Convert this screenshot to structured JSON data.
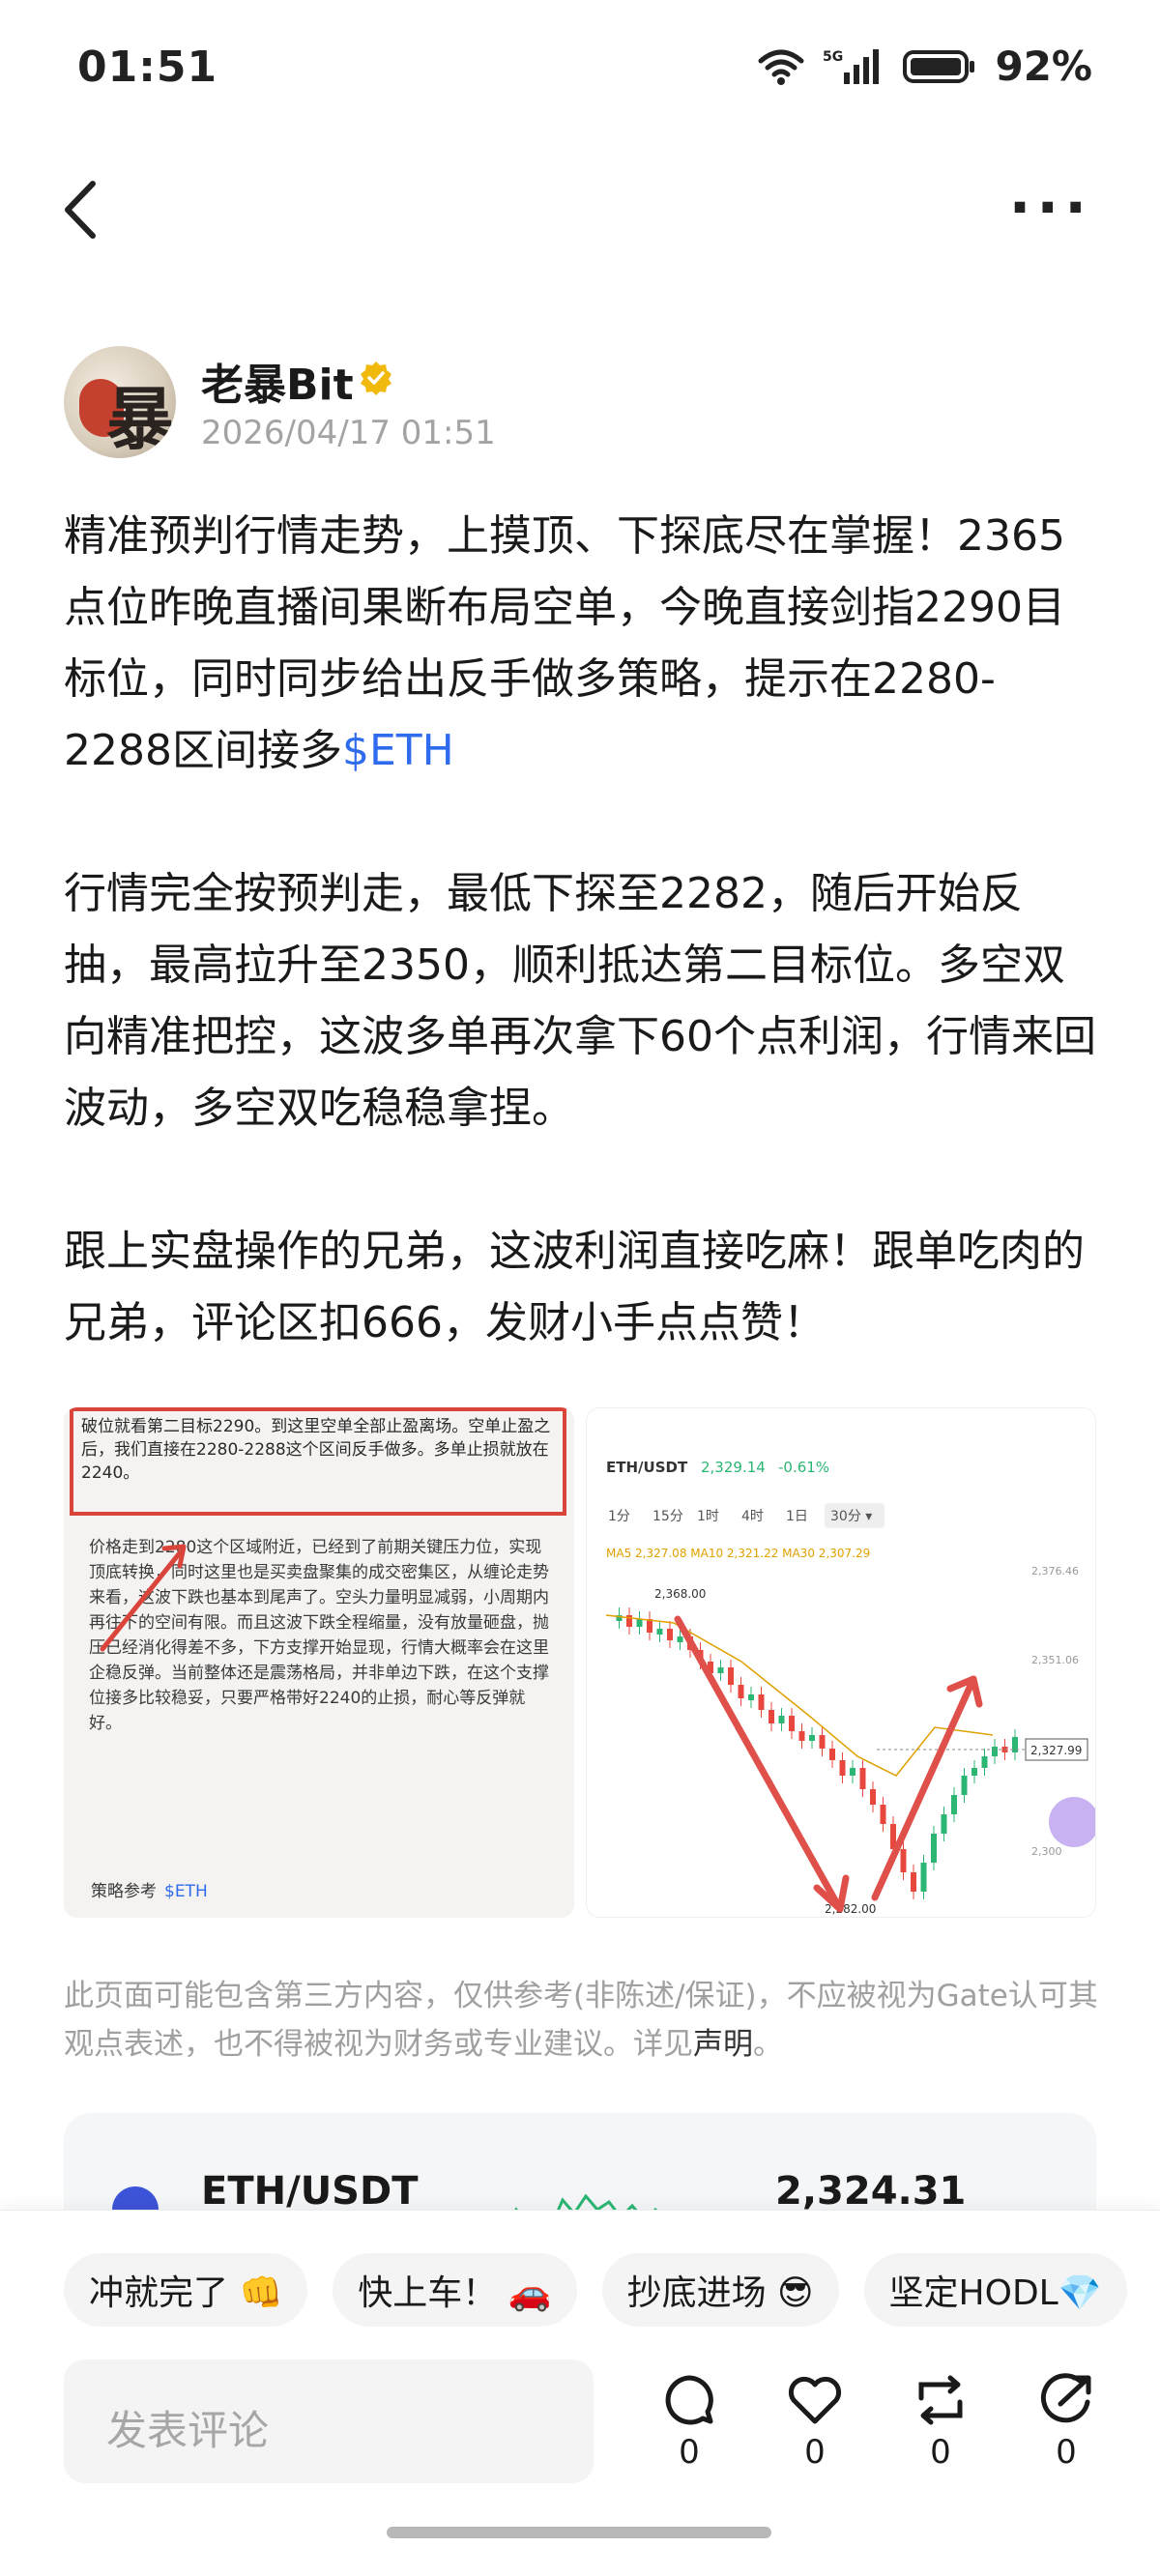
{
  "status_bar": {
    "time": "01:51",
    "network": "5G",
    "battery": "92%"
  },
  "author": {
    "name": "老暴Bit",
    "time": "2026/04/17 01:51",
    "avatar_text": "暴"
  },
  "post": {
    "p1": "精准预判行情走势，上摸顶、下探底尽在掌握！2365点位昨晚直播间果断布局空单，今晚直接剑指2290目标位，同时同步给出反手做多策略，提示在2280-2288区间接多",
    "p1_tag": "$ETH",
    "p2": "行情完全按预判走，最低下探至2282，随后开始反抽，最高拉升至2350，顺利抵达第二目标位。多空双向精准把控，这波多单再次拿下60个点利润，行情来回波动，多空双吃稳稳拿捏。",
    "p3": "跟上实盘操作的兄弟，这波利润直接吃麻！跟单吃肉的兄弟，评论区扣666，发财小手点点赞！"
  },
  "image_left": {
    "box_text": "破位就看第二目标2290。到这里空单全部止盈离场。空单止盈之后，我们直接在2280-2288这个区间反手做多。多单止损就放在2240。",
    "body_text": "价格走到2280这个区域附近，已经到了前期关键压力位，实现顶底转换，同时这里也是买卖盘聚集的成交密集区，从缠论走势来看，这波下跌也基本到尾声了。空头力量明显减弱，小周期内再往下的空间有限。而且这波下跌全程缩量，没有放量砸盘，抛压已经消化得差不多，下方支撑开始显现，行情大概率会在这里企稳反弹。当前整体还是震荡格局，并非单边下跌，在这个支撑位接多比较稳妥，只要严格带好2240的止损，耐心等反弹就好。",
    "footer": "策略参考",
    "footer_tag": "$ETH"
  },
  "image_right": {
    "pair": "ETH/USDT",
    "price": "2,329.14",
    "change": "-0.61%",
    "timeframes": [
      "1分",
      "15分",
      "1时",
      "4时",
      "1日",
      "30分 ▾"
    ],
    "ma_text": "MA5 2,327.08  MA10 2,321.22  MA30 2,307.29",
    "high_label": "2,368.00",
    "low_label": "2,282.00",
    "current_label": "2,327.99",
    "axis": [
      "2,376.46",
      "2,351.06",
      "2,300"
    ]
  },
  "disclaimer": {
    "text": "此页面可能包含第三方内容，仅供参考(非陈述/保证)，不应被视为Gate认可其观点表述，也不得被视为财务或专业建议。详见",
    "link": "声明",
    "end": "。"
  },
  "ticker": {
    "pair": "ETH/USDT",
    "price": "2,324.31"
  },
  "chips": [
    "冲就完了 👊",
    "快上车！ 🚗",
    "抄底进场 😎",
    "坚定HODL💎"
  ],
  "comment": {
    "placeholder": "发表评论"
  },
  "actions": {
    "comment": "0",
    "like": "0",
    "repost": "0",
    "share": "0"
  },
  "colors": {
    "link": "#2f6bed",
    "up": "#2bb673",
    "down": "#e8473e",
    "arrow": "#e0504a"
  }
}
